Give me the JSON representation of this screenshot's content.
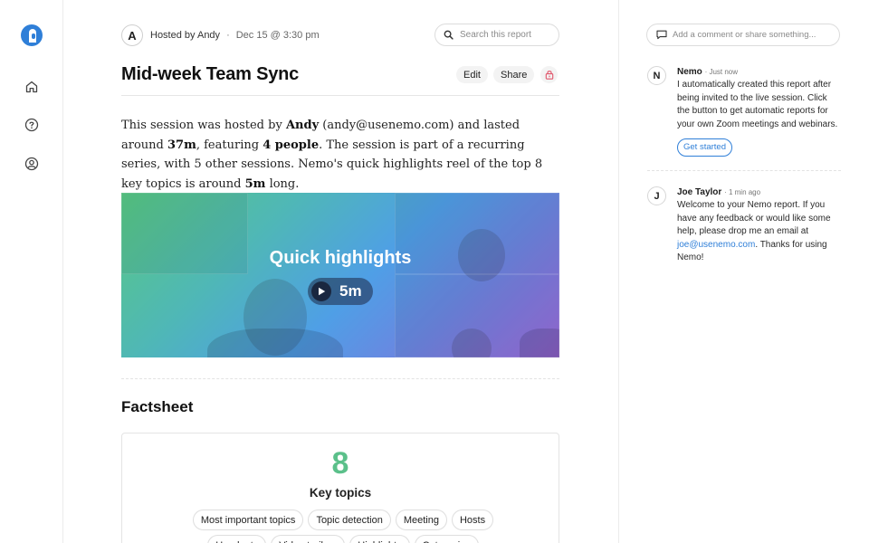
{
  "nav": {
    "items": [
      {
        "name": "home",
        "icon": "home-icon"
      },
      {
        "name": "help",
        "icon": "help-circle-icon"
      },
      {
        "name": "profile",
        "icon": "user-circle-icon"
      }
    ]
  },
  "header": {
    "host_initial": "A",
    "hosted_by": "Hosted by Andy",
    "separator": "·",
    "date": "Dec 15 @ 3:30 pm",
    "search_placeholder": "Search this report"
  },
  "report": {
    "title": "Mid-week Team Sync",
    "edit_label": "Edit",
    "share_label": "Share",
    "lock_icon": "lock-icon",
    "summary": {
      "p1": "This session was hosted by ",
      "host": "Andy",
      "p2": " (andy@usenemo.com) and lasted around ",
      "duration": "37m",
      "p3": ", featuring ",
      "people": "4 people",
      "p4": ". The session is part of a recurring series, with 5 other sessions. Nemo's quick highlights reel of the top 8 key topics is around ",
      "reel": "5m",
      "p5": " long."
    },
    "highlights": {
      "title": "Quick highlights",
      "duration": "5m"
    }
  },
  "factsheet": {
    "title": "Factsheet",
    "number": "8",
    "label": "Key topics",
    "chips": [
      "Most important topics",
      "Topic detection",
      "Meeting",
      "Hosts",
      "Handouts",
      "Video trailers",
      "Highlights",
      "Categories"
    ]
  },
  "comments": {
    "placeholder": "Add a comment or share something...",
    "items": [
      {
        "initial": "N",
        "name": "Nemo",
        "time": "· Just now",
        "text": "I automatically created this report after being invited to the live session. Click the button to get automatic reports for your own Zoom meetings and webinars.",
        "button": "Get started"
      },
      {
        "initial": "J",
        "name": "Joe Taylor",
        "time": "· 1 min ago",
        "text_before": "Welcome to your Nemo report. If you have any feedback or would like some help, please drop me an email at ",
        "email": "joe@usenemo.com",
        "text_after": ". Thanks for using Nemo!"
      }
    ]
  },
  "colors": {
    "accent": "#2f7fd8",
    "factsheet_number": "#5bc08a",
    "lock": "#e0556a"
  }
}
